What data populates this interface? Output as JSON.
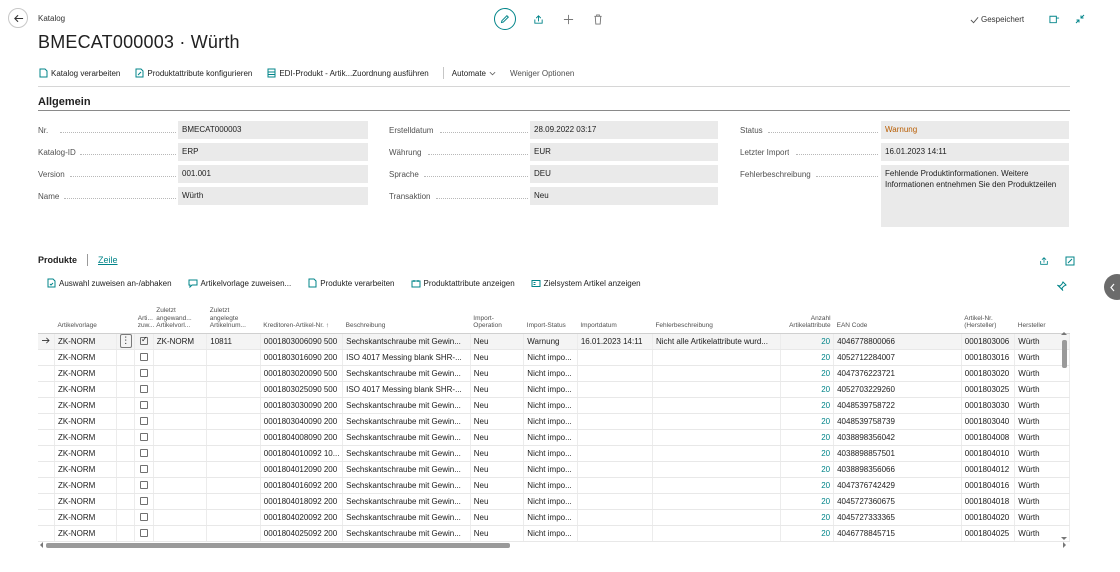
{
  "header": {
    "caption": "Katalog",
    "title": "BMECAT000003 · Würth",
    "saved_label": "Gespeichert"
  },
  "actions": [
    {
      "label": "Katalog verarbeiten",
      "icon": "process-doc-icon"
    },
    {
      "label": "Produktattribute konfigurieren",
      "icon": "edit-doc-icon"
    },
    {
      "label": "EDI-Produkt - Artik...Zuordnung ausführen",
      "icon": "table-icon"
    }
  ],
  "actions_more": {
    "automate": "Automate",
    "fewer": "Weniger Optionen"
  },
  "section": {
    "title": "Allgemein"
  },
  "fields": {
    "col1": [
      {
        "label": "Nr.",
        "value": "BMECAT000003"
      },
      {
        "label": "Katalog-ID",
        "value": "ERP"
      },
      {
        "label": "Version",
        "value": "001.001"
      },
      {
        "label": "Name",
        "value": "Würth"
      }
    ],
    "col2": [
      {
        "label": "Erstelldatum",
        "value": "28.09.2022 03:17"
      },
      {
        "label": "Währung",
        "value": "EUR"
      },
      {
        "label": "Sprache",
        "value": "DEU"
      },
      {
        "label": "Transaktion",
        "value": "Neu"
      }
    ],
    "col3": [
      {
        "label": "Status",
        "value": "Warnung"
      },
      {
        "label": "Letzter Import",
        "value": "16.01.2023 14:11"
      },
      {
        "label": "Fehlerbeschreibung",
        "value": "Fehlende Produktinformationen. Weitere Informationen entnehmen Sie den Produktzeilen"
      }
    ]
  },
  "products": {
    "tab": "Produkte",
    "tab_link": "Zeile",
    "actions": [
      {
        "label": "Auswahl zuweisen an-/abhaken"
      },
      {
        "label": "Artikelvorlage zuweisen..."
      },
      {
        "label": "Produkte verarbeiten"
      },
      {
        "label": "Produktattribute anzeigen"
      },
      {
        "label": "Zielsystem Artikel anzeigen"
      }
    ],
    "columns": [
      "Artikelvorlage",
      "Arti... zuw...",
      "Zuletzt angewand... Artikelvorl...",
      "Zuletzt angelegte Artikelnum...",
      "Kreditoren-Artikel-Nr. ↑",
      "Beschreibung",
      "Import-Operation",
      "Import-Status",
      "Importdatum",
      "Fehlerbeschreibung",
      "Anzahl Artikelattribute",
      "EAN Code",
      "Artikel-Nr. (Hersteller)",
      "Hersteller"
    ],
    "rows": [
      {
        "template": "ZK-NORM",
        "checked": true,
        "last_template": "ZK-NORM",
        "last_item": "10811",
        "vendor_no": "0001803006090 500",
        "desc": "Sechskantschraube mit Gewin...",
        "op": "Neu",
        "status": "Warnung",
        "date": "16.01.2023 14:11",
        "error": "Nicht alle Artikelattribute wurd...",
        "count": "20",
        "ean": "4046778800066",
        "mfr_no": "0001803006",
        "mfr": "Würth"
      },
      {
        "template": "ZK-NORM",
        "checked": false,
        "last_template": "",
        "last_item": "",
        "vendor_no": "0001803016090 200",
        "desc": "ISO 4017 Messing blank SHR-...",
        "op": "Neu",
        "status": "Nicht impo...",
        "date": "",
        "error": "",
        "count": "20",
        "ean": "4052712284007",
        "mfr_no": "0001803016",
        "mfr": "Würth"
      },
      {
        "template": "ZK-NORM",
        "checked": false,
        "last_template": "",
        "last_item": "",
        "vendor_no": "0001803020090 500",
        "desc": "Sechskantschraube mit Gewin...",
        "op": "Neu",
        "status": "Nicht impo...",
        "date": "",
        "error": "",
        "count": "20",
        "ean": "4047376223721",
        "mfr_no": "0001803020",
        "mfr": "Würth"
      },
      {
        "template": "ZK-NORM",
        "checked": false,
        "last_template": "",
        "last_item": "",
        "vendor_no": "0001803025090 500",
        "desc": "ISO 4017 Messing blank SHR-...",
        "op": "Neu",
        "status": "Nicht impo...",
        "date": "",
        "error": "",
        "count": "20",
        "ean": "4052703229260",
        "mfr_no": "0001803025",
        "mfr": "Würth"
      },
      {
        "template": "ZK-NORM",
        "checked": false,
        "last_template": "",
        "last_item": "",
        "vendor_no": "0001803030090 200",
        "desc": "Sechskantschraube mit Gewin...",
        "op": "Neu",
        "status": "Nicht impo...",
        "date": "",
        "error": "",
        "count": "20",
        "ean": "4048539758722",
        "mfr_no": "0001803030",
        "mfr": "Würth"
      },
      {
        "template": "ZK-NORM",
        "checked": false,
        "last_template": "",
        "last_item": "",
        "vendor_no": "0001803040090 200",
        "desc": "Sechskantschraube mit Gewin...",
        "op": "Neu",
        "status": "Nicht impo...",
        "date": "",
        "error": "",
        "count": "20",
        "ean": "4048539758739",
        "mfr_no": "0001803040",
        "mfr": "Würth"
      },
      {
        "template": "ZK-NORM",
        "checked": false,
        "last_template": "",
        "last_item": "",
        "vendor_no": "0001804008090 200",
        "desc": "Sechskantschraube mit Gewin...",
        "op": "Neu",
        "status": "Nicht impo...",
        "date": "",
        "error": "",
        "count": "20",
        "ean": "4038898356042",
        "mfr_no": "0001804008",
        "mfr": "Würth"
      },
      {
        "template": "ZK-NORM",
        "checked": false,
        "last_template": "",
        "last_item": "",
        "vendor_no": "0001804010092 10...",
        "desc": "Sechskantschraube mit Gewin...",
        "op": "Neu",
        "status": "Nicht impo...",
        "date": "",
        "error": "",
        "count": "20",
        "ean": "4038898857501",
        "mfr_no": "0001804010",
        "mfr": "Würth"
      },
      {
        "template": "ZK-NORM",
        "checked": false,
        "last_template": "",
        "last_item": "",
        "vendor_no": "0001804012090 200",
        "desc": "Sechskantschraube mit Gewin...",
        "op": "Neu",
        "status": "Nicht impo...",
        "date": "",
        "error": "",
        "count": "20",
        "ean": "4038898356066",
        "mfr_no": "0001804012",
        "mfr": "Würth"
      },
      {
        "template": "ZK-NORM",
        "checked": false,
        "last_template": "",
        "last_item": "",
        "vendor_no": "0001804016092 200",
        "desc": "Sechskantschraube mit Gewin...",
        "op": "Neu",
        "status": "Nicht impo...",
        "date": "",
        "error": "",
        "count": "20",
        "ean": "4047376742429",
        "mfr_no": "0001804016",
        "mfr": "Würth"
      },
      {
        "template": "ZK-NORM",
        "checked": false,
        "last_template": "",
        "last_item": "",
        "vendor_no": "0001804018092 200",
        "desc": "Sechskantschraube mit Gewin...",
        "op": "Neu",
        "status": "Nicht impo...",
        "date": "",
        "error": "",
        "count": "20",
        "ean": "4045727360675",
        "mfr_no": "0001804018",
        "mfr": "Würth"
      },
      {
        "template": "ZK-NORM",
        "checked": false,
        "last_template": "",
        "last_item": "",
        "vendor_no": "0001804020092 200",
        "desc": "Sechskantschraube mit Gewin...",
        "op": "Neu",
        "status": "Nicht impo...",
        "date": "",
        "error": "",
        "count": "20",
        "ean": "4045727333365",
        "mfr_no": "0001804020",
        "mfr": "Würth"
      },
      {
        "template": "ZK-NORM",
        "checked": false,
        "last_template": "",
        "last_item": "",
        "vendor_no": "0001804025092 200",
        "desc": "Sechskantschraube mit Gewin...",
        "op": "Neu",
        "status": "Nicht impo...",
        "date": "",
        "error": "",
        "count": "20",
        "ean": "4046778845715",
        "mfr_no": "0001804025",
        "mfr": "Würth"
      }
    ]
  },
  "colors": {
    "accent": "#008489",
    "warning": "#b85c00",
    "field_bg": "#eaeaea"
  }
}
